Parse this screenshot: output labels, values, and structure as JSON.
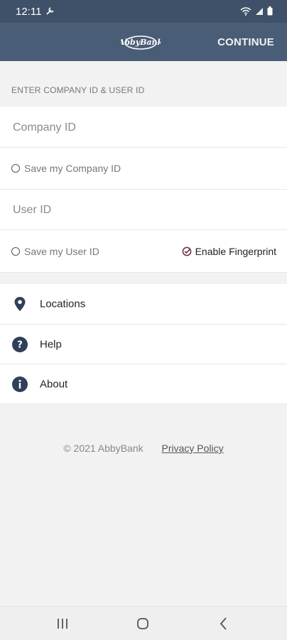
{
  "status_bar": {
    "time": "12:11"
  },
  "app_bar": {
    "logo_text": "AbbyBank",
    "continue_label": "CONTINUE"
  },
  "login": {
    "section_header": "ENTER COMPANY ID & USER ID",
    "company_id_placeholder": "Company ID",
    "save_company_id_label": "Save my Company ID",
    "user_id_placeholder": "User ID",
    "save_user_id_label": "Save my User ID",
    "enable_fingerprint_label": "Enable Fingerprint"
  },
  "menu": {
    "items": [
      {
        "label": "Locations",
        "icon": "location-pin-icon"
      },
      {
        "label": "Help",
        "icon": "help-icon"
      },
      {
        "label": "About",
        "icon": "info-icon"
      }
    ]
  },
  "footer": {
    "copyright": "© 2021 AbbyBank",
    "privacy_link": "Privacy Policy"
  },
  "colors": {
    "header_bg": "#4a5d76",
    "status_bg": "#3f5168",
    "icon_navy": "#2f4059",
    "fingerprint_accent": "#6b2b4a"
  }
}
